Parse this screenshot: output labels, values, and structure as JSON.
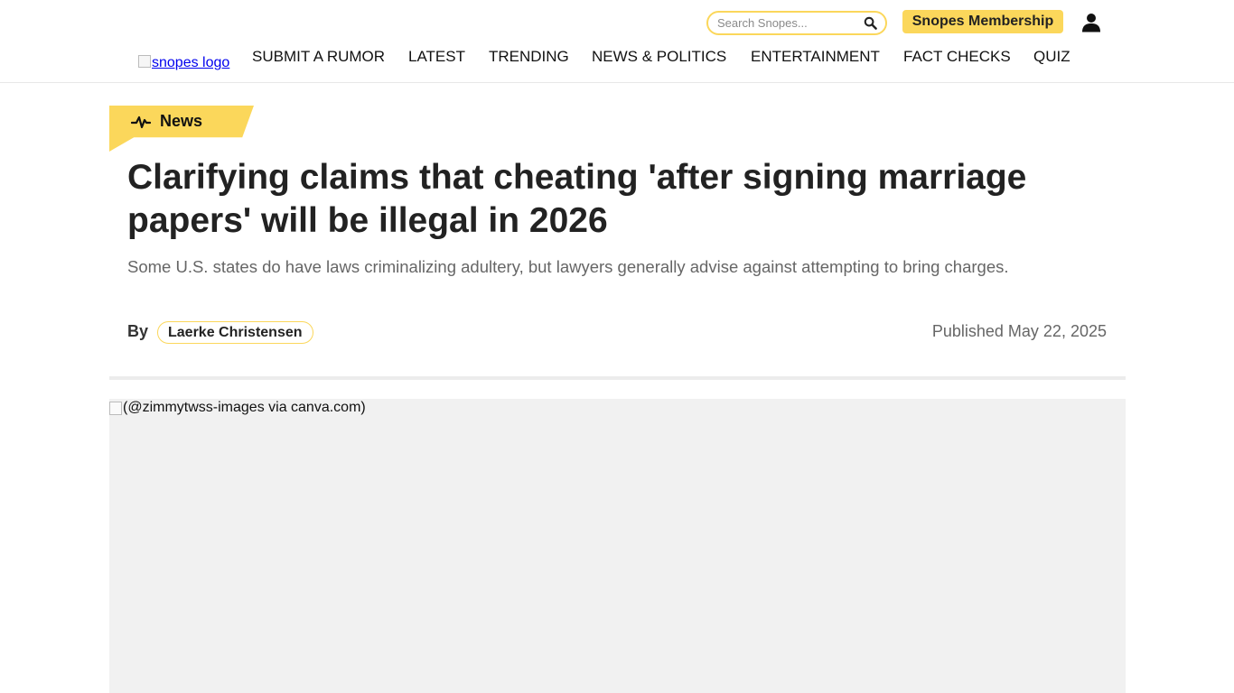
{
  "header": {
    "search_placeholder": "Search Snopes...",
    "membership_label": "Snopes Membership",
    "logo_alt": "snopes logo",
    "nav": [
      "SUBMIT A RUMOR",
      "LATEST",
      "TRENDING",
      "NEWS & POLITICS",
      "ENTERTAINMENT",
      "FACT CHECKS",
      "QUIZ"
    ]
  },
  "article": {
    "category": "News",
    "title": "Clarifying claims that cheating 'after signing marriage papers' will be illegal in 2026",
    "subtitle": "Some U.S. states do have laws criminalizing adultery, but lawyers generally advise against attempting to bring charges.",
    "byline_prefix": "By",
    "author": "Laerke Christensen",
    "published": "Published May 22, 2025",
    "hero_alt": "(@zimmytwss-images via canva.com)"
  },
  "colors": {
    "accent": "#fbd75b",
    "text": "#222222",
    "muted": "#666666",
    "hero_placeholder": "#f1f1f1"
  },
  "icons": {
    "search": "magnifier-icon",
    "user": "user-icon",
    "category": "pulse-icon"
  }
}
